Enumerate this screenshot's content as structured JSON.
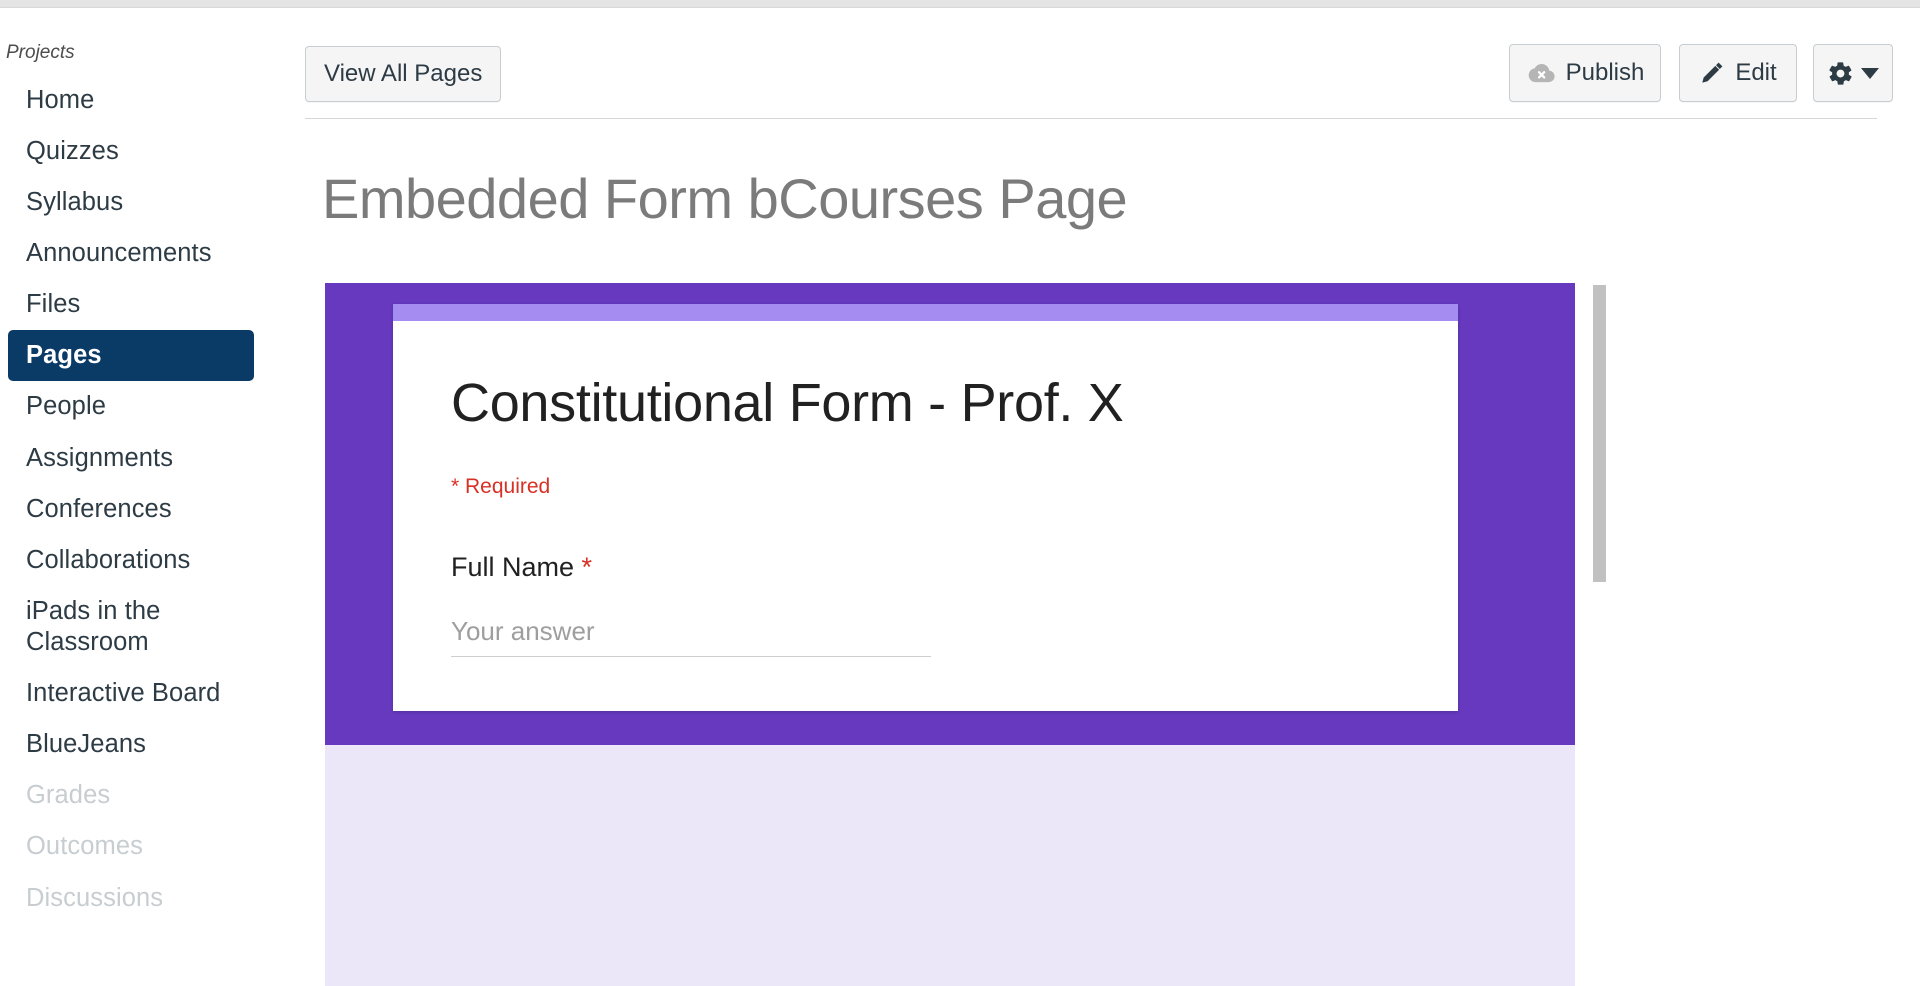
{
  "sidebar": {
    "heading": "Projects",
    "items": [
      {
        "label": "Home",
        "state": "normal"
      },
      {
        "label": "Quizzes",
        "state": "normal"
      },
      {
        "label": "Syllabus",
        "state": "normal"
      },
      {
        "label": "Announcements",
        "state": "normal"
      },
      {
        "label": "Files",
        "state": "normal"
      },
      {
        "label": "Pages",
        "state": "active"
      },
      {
        "label": "People",
        "state": "normal"
      },
      {
        "label": "Assignments",
        "state": "normal"
      },
      {
        "label": "Conferences",
        "state": "normal"
      },
      {
        "label": "Collaborations",
        "state": "normal"
      },
      {
        "label": "iPads in the Classroom",
        "state": "normal"
      },
      {
        "label": "Interactive Board",
        "state": "normal"
      },
      {
        "label": "BlueJeans",
        "state": "normal"
      },
      {
        "label": "Grades",
        "state": "dim"
      },
      {
        "label": "Outcomes",
        "state": "dim"
      },
      {
        "label": "Discussions",
        "state": "dim"
      }
    ],
    "active_color": "#0a3a66",
    "dim_color": "#c7cdd1"
  },
  "toolbar": {
    "view_all_pages_label": "View All Pages",
    "publish_label": "Publish",
    "publish_icon": "cloud-x-icon",
    "edit_label": "Edit",
    "edit_icon": "pencil-icon",
    "settings_icon": "gear-icon",
    "settings_caret": "chevron-down-icon"
  },
  "page": {
    "title": "Embedded Form bCourses Page",
    "title_color": "#7b7b7b"
  },
  "embedded_form": {
    "hero_color": "#6639bf",
    "body_color": "#ece7f8",
    "accent_color": "#a48cf0",
    "title": "Constitutional Form - Prof. X",
    "required_note": "* Required",
    "required_color": "#d93025",
    "fields": [
      {
        "label": "Full Name",
        "required_marker": "*",
        "placeholder": "Your answer",
        "value": ""
      }
    ],
    "scrollbar": {
      "name": "iframe-vertical-scrollbar",
      "thumb_color": "#c1c1c1"
    }
  }
}
